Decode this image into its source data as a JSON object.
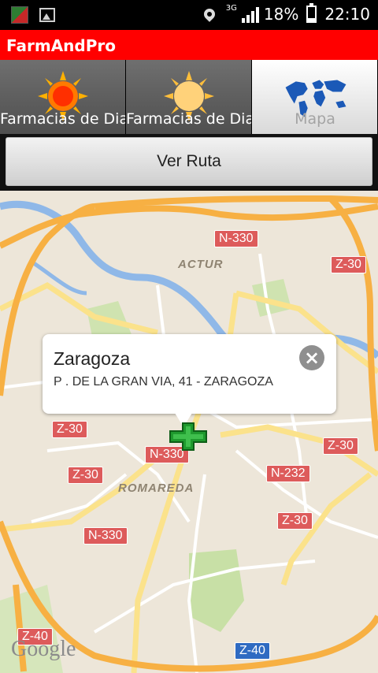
{
  "status_bar": {
    "network": "3G",
    "battery": "18%",
    "time": "22:10",
    "icons": [
      "app-icon",
      "image-icon",
      "location-icon",
      "signal-icon",
      "battery-icon"
    ]
  },
  "app": {
    "title": "FarmAndPro"
  },
  "tabs": [
    {
      "label": "Farmacias de Dia",
      "icon": "sun-icon",
      "selected": false
    },
    {
      "label": "Farmacias de Dia",
      "icon": "sun-moon-icon",
      "selected": false
    },
    {
      "label": "Mapa",
      "icon": "world-map-icon",
      "selected": true
    }
  ],
  "route_button": {
    "label": "Ver Ruta"
  },
  "map": {
    "road_labels": [
      "N-330",
      "Z-30",
      "Z-30",
      "Z-30",
      "N-330",
      "Z-30",
      "N-232",
      "Z-30",
      "N-330",
      "Z-40",
      "Z-40"
    ],
    "districts": [
      "ACTUR",
      "ROMAREDA"
    ],
    "attribution": "Google",
    "accent_colors": {
      "highway": "#f7b043",
      "major_road": "#fbe28b",
      "river": "#8fb8e8",
      "park": "#c8e0a6",
      "shield_red": "#dd5b5b",
      "shield_blue": "#2f6bc2"
    }
  },
  "callout": {
    "title": "Zaragoza",
    "address": "P . DE LA GRAN VIA, 41 - ZARAGOZA",
    "close_icon": "close-icon"
  },
  "marker": {
    "icon": "pharmacy-cross-icon",
    "color": "#1f9a2e"
  }
}
